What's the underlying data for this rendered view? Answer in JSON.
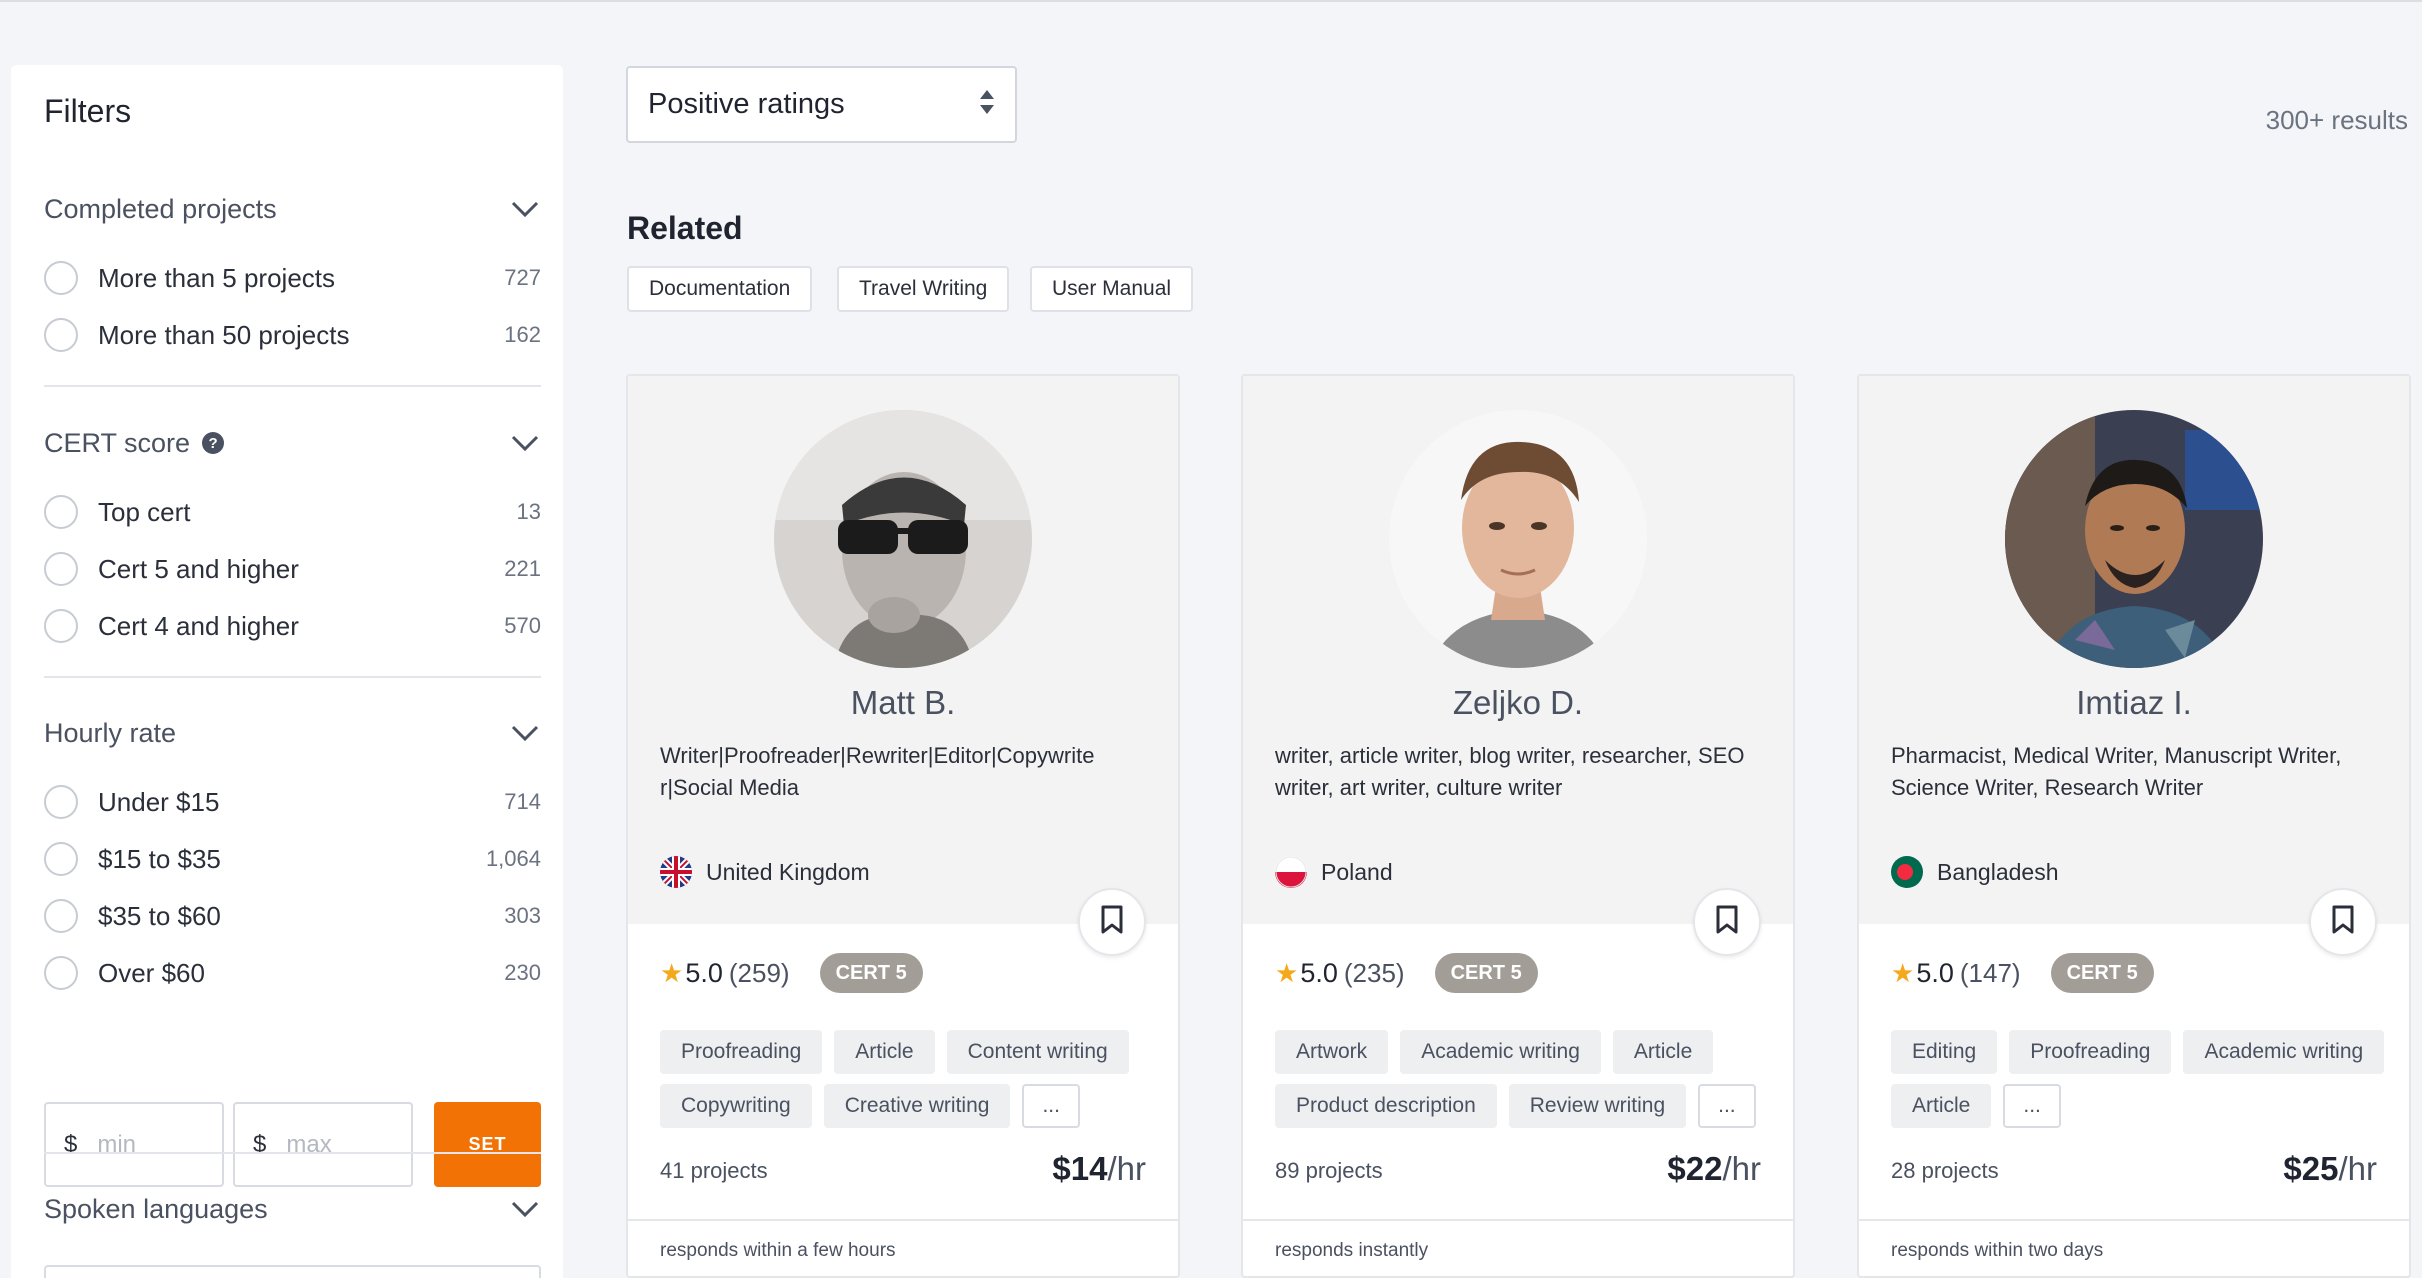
{
  "sidebar": {
    "title": "Filters",
    "sections": {
      "completed": {
        "title": "Completed projects",
        "options": [
          {
            "label": "More than 5 projects",
            "count": "727"
          },
          {
            "label": "More than 50 projects",
            "count": "162"
          }
        ]
      },
      "cert": {
        "title": "CERT score",
        "help_icon": "?",
        "options": [
          {
            "label": "Top cert",
            "count": "13"
          },
          {
            "label": "Cert 5 and higher",
            "count": "221"
          },
          {
            "label": "Cert 4 and higher",
            "count": "570"
          }
        ]
      },
      "hourly": {
        "title": "Hourly rate",
        "options": [
          {
            "label": "Under $15",
            "count": "714"
          },
          {
            "label": "$15 to $35",
            "count": "1,064"
          },
          {
            "label": "$35 to $60",
            "count": "303"
          },
          {
            "label": "Over $60",
            "count": "230"
          }
        ],
        "min_currency": "$",
        "min_placeholder": "min",
        "max_currency": "$",
        "max_placeholder": "max",
        "set_label": "SET"
      },
      "languages": {
        "title": "Spoken languages"
      }
    }
  },
  "toolbar": {
    "sort_value": "Positive ratings",
    "results": "300+ results"
  },
  "related": {
    "title": "Related",
    "tags": [
      "Documentation",
      "Travel Writing",
      "User Manual"
    ]
  },
  "colors": {
    "accent": "#f27205",
    "cert_badge": "#a29d97",
    "star": "#f4a91c"
  },
  "cards": [
    {
      "name": "Matt B.",
      "bio": "Writer|Proofreader|Rewriter|Editor|Copywrite r|Social Media",
      "country": "United Kingdom",
      "rating": "5.0",
      "reviews": "(259)",
      "cert": "CERT 5",
      "skills": [
        "Proofreading",
        "Article",
        "Content writing",
        "Copywriting",
        "Creative writing",
        "..."
      ],
      "projects": "41 projects",
      "rate": "$14",
      "rate_unit": "/hr",
      "response": "responds within a few hours"
    },
    {
      "name": "Zeljko D.",
      "bio": "writer, article writer, blog writer, researcher, SEO writer, art writer, culture writer",
      "country": "Poland",
      "rating": "5.0",
      "reviews": "(235)",
      "cert": "CERT 5",
      "skills": [
        "Artwork",
        "Academic writing",
        "Article",
        "Product description",
        "Review writing",
        "..."
      ],
      "projects": "89 projects",
      "rate": "$22",
      "rate_unit": "/hr",
      "response": "responds instantly"
    },
    {
      "name": "Imtiaz I.",
      "bio": "Pharmacist, Medical Writer, Manuscript Writer, Science Writer, Research Writer",
      "country": "Bangladesh",
      "rating": "5.0",
      "reviews": "(147)",
      "cert": "CERT 5",
      "skills": [
        "Editing",
        "Proofreading",
        "Academic writing",
        "Article",
        "..."
      ],
      "projects": "28 projects",
      "rate": "$25",
      "rate_unit": "/hr",
      "response": "responds within two days"
    }
  ]
}
